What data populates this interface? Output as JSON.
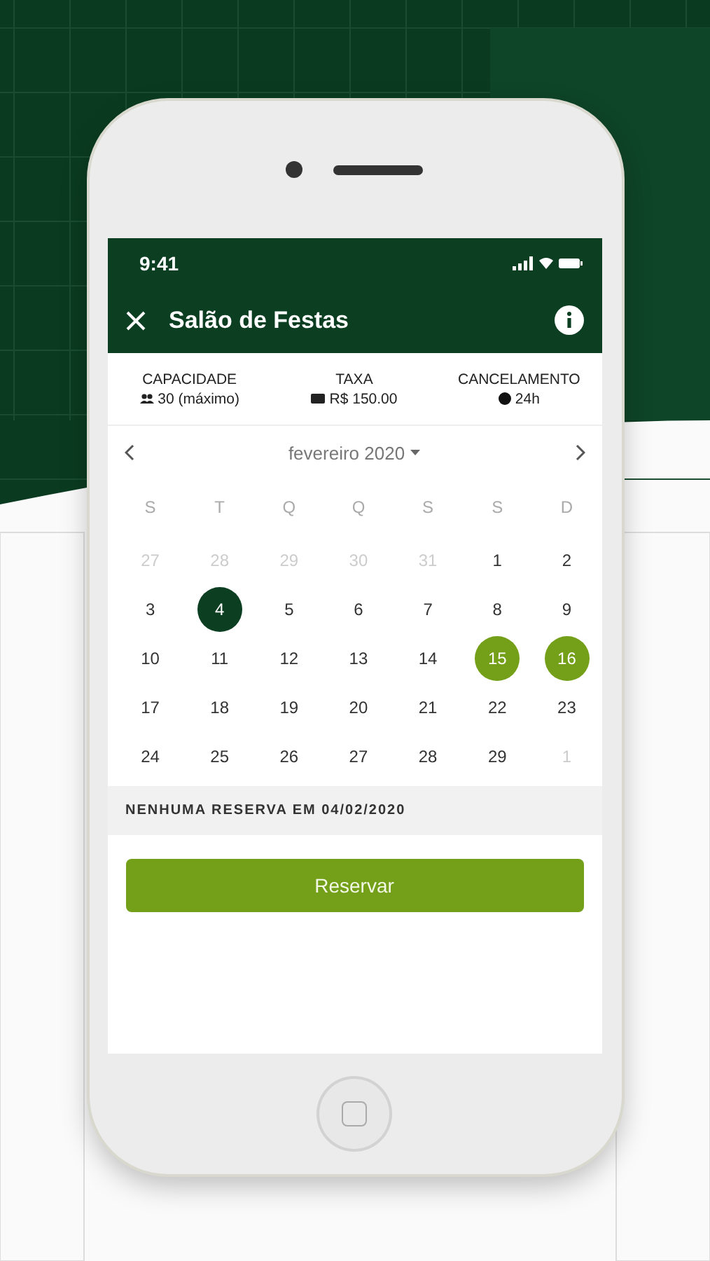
{
  "status_bar": {
    "time": "9:41"
  },
  "nav_bar": {
    "title": "Salão de Festas"
  },
  "stats": [
    {
      "label": "CAPACIDADE",
      "value": "30 (máximo)"
    },
    {
      "label": "TAXA",
      "value": "R$ 150.00"
    },
    {
      "label": "CANCELAMENTO",
      "value": "24h"
    }
  ],
  "calendar": {
    "month": "fevereiro 2020",
    "weekdays": [
      "S",
      "T",
      "Q",
      "Q",
      "S",
      "S",
      "D"
    ],
    "days": [
      {
        "label": "27",
        "muted": true,
        "selected": false,
        "marked": false
      },
      {
        "label": "28",
        "muted": true,
        "selected": false,
        "marked": false
      },
      {
        "label": "29",
        "muted": true,
        "selected": false,
        "marked": false
      },
      {
        "label": "30",
        "muted": true,
        "selected": false,
        "marked": false
      },
      {
        "label": "31",
        "muted": true,
        "selected": false,
        "marked": false
      },
      {
        "label": "1",
        "muted": false,
        "selected": false,
        "marked": false
      },
      {
        "label": "2",
        "muted": false,
        "selected": false,
        "marked": false
      },
      {
        "label": "3",
        "muted": false,
        "selected": false,
        "marked": false
      },
      {
        "label": "4",
        "muted": false,
        "selected": true,
        "marked": false
      },
      {
        "label": "5",
        "muted": false,
        "selected": false,
        "marked": false
      },
      {
        "label": "6",
        "muted": false,
        "selected": false,
        "marked": false
      },
      {
        "label": "7",
        "muted": false,
        "selected": false,
        "marked": false
      },
      {
        "label": "8",
        "muted": false,
        "selected": false,
        "marked": false
      },
      {
        "label": "9",
        "muted": false,
        "selected": false,
        "marked": false
      },
      {
        "label": "10",
        "muted": false,
        "selected": false,
        "marked": false
      },
      {
        "label": "11",
        "muted": false,
        "selected": false,
        "marked": false
      },
      {
        "label": "12",
        "muted": false,
        "selected": false,
        "marked": false
      },
      {
        "label": "13",
        "muted": false,
        "selected": false,
        "marked": false
      },
      {
        "label": "14",
        "muted": false,
        "selected": false,
        "marked": false
      },
      {
        "label": "15",
        "muted": false,
        "selected": false,
        "marked": true
      },
      {
        "label": "16",
        "muted": false,
        "selected": false,
        "marked": true
      },
      {
        "label": "17",
        "muted": false,
        "selected": false,
        "marked": false
      },
      {
        "label": "18",
        "muted": false,
        "selected": false,
        "marked": false
      },
      {
        "label": "19",
        "muted": false,
        "selected": false,
        "marked": false
      },
      {
        "label": "20",
        "muted": false,
        "selected": false,
        "marked": false
      },
      {
        "label": "21",
        "muted": false,
        "selected": false,
        "marked": false
      },
      {
        "label": "22",
        "muted": false,
        "selected": false,
        "marked": false
      },
      {
        "label": "23",
        "muted": false,
        "selected": false,
        "marked": false
      },
      {
        "label": "24",
        "muted": false,
        "selected": false,
        "marked": false
      },
      {
        "label": "25",
        "muted": false,
        "selected": false,
        "marked": false
      },
      {
        "label": "26",
        "muted": false,
        "selected": false,
        "marked": false
      },
      {
        "label": "27",
        "muted": false,
        "selected": false,
        "marked": false
      },
      {
        "label": "28",
        "muted": false,
        "selected": false,
        "marked": false
      },
      {
        "label": "29",
        "muted": false,
        "selected": false,
        "marked": false
      },
      {
        "label": "1",
        "muted": true,
        "selected": false,
        "marked": false
      }
    ]
  },
  "notice": "NENHUMA RESERVA EM 04/02/2020",
  "primary_button": "Reservar"
}
